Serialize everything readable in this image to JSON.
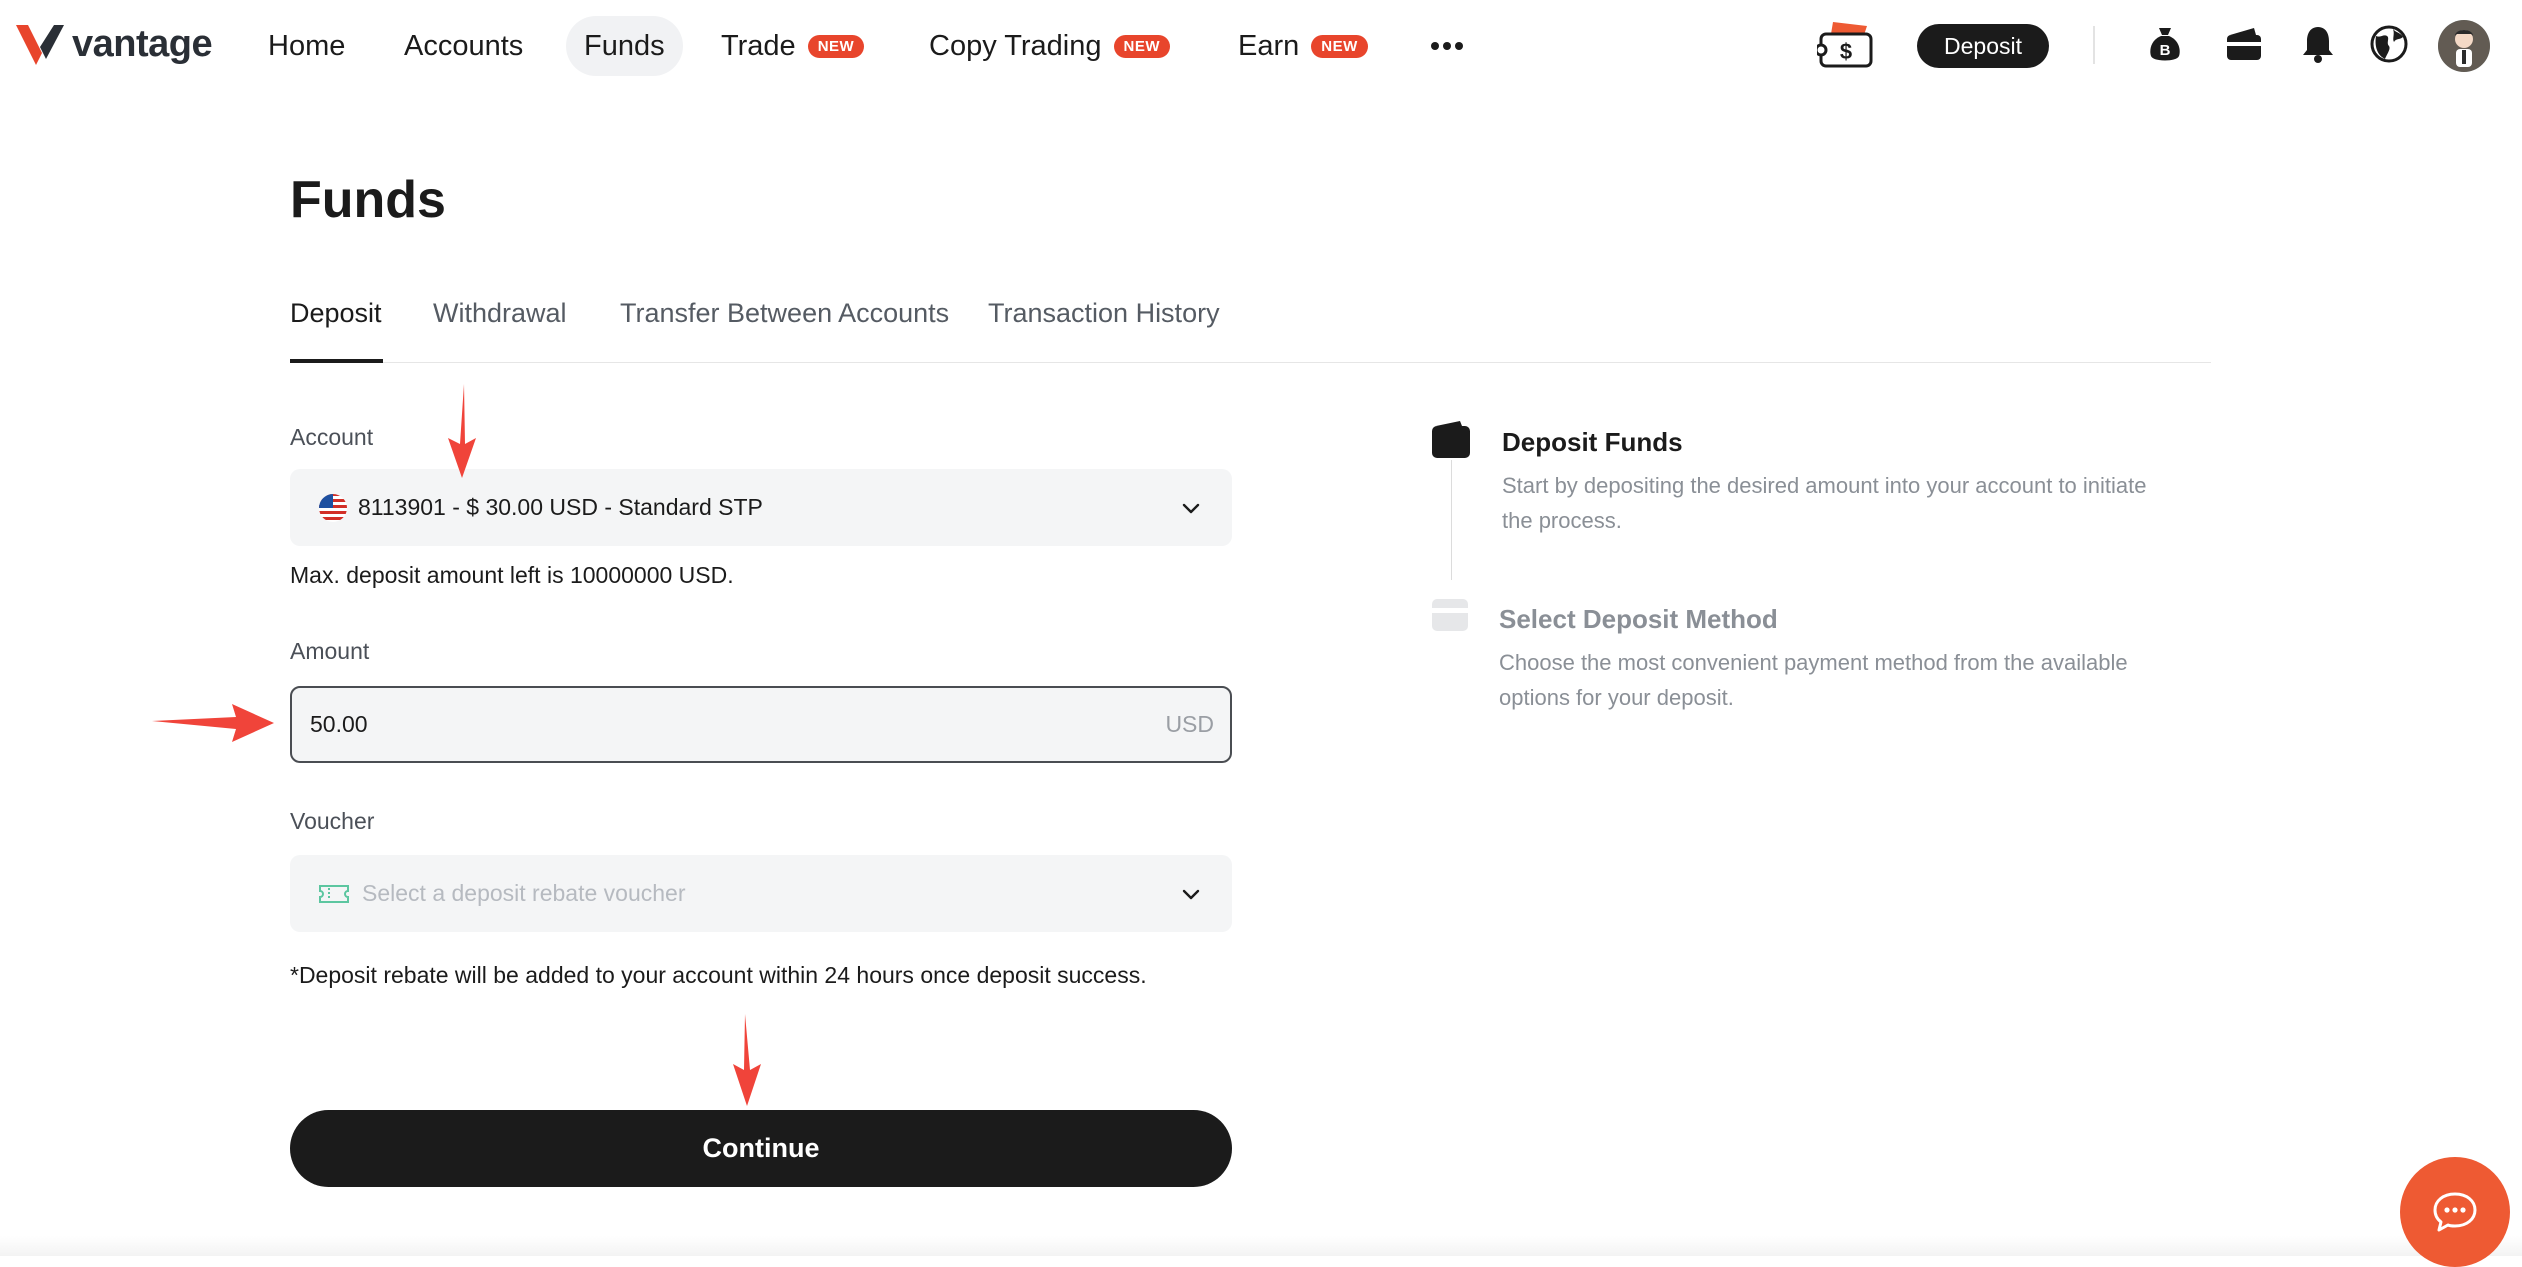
{
  "brand": {
    "name": "vantage",
    "accent": "#e8452c"
  },
  "nav": {
    "items": [
      {
        "label": "Home"
      },
      {
        "label": "Accounts"
      },
      {
        "label": "Funds"
      },
      {
        "label": "Trade",
        "badge": "NEW"
      },
      {
        "label": "Copy Trading",
        "badge": "NEW"
      },
      {
        "label": "Earn",
        "badge": "NEW"
      }
    ],
    "more_icon": "more-horizontal-icon",
    "deposit_label": "Deposit",
    "icons": [
      "cashback-icon",
      "bitcoin-bag-icon",
      "wallet-icon",
      "bell-icon",
      "globe-icon",
      "user-avatar"
    ]
  },
  "page": {
    "title": "Funds",
    "tabs": [
      {
        "label": "Deposit",
        "active": true
      },
      {
        "label": "Withdrawal"
      },
      {
        "label": "Transfer Between Accounts"
      },
      {
        "label": "Transaction History"
      }
    ]
  },
  "form": {
    "account_label": "Account",
    "account_value": "8113901 - $ 30.00 USD - Standard STP",
    "max_note": "Max. deposit amount left is 10000000 USD.",
    "amount_label": "Amount",
    "amount_value": "50.00",
    "amount_currency": "USD",
    "voucher_label": "Voucher",
    "voucher_placeholder": "Select a deposit rebate voucher",
    "rebate_note": "*Deposit rebate will be added to your account within 24 hours once deposit success.",
    "continue_label": "Continue"
  },
  "steps": [
    {
      "title": "Deposit Funds",
      "desc": "Start by depositing the desired amount into your account to initiate the process.",
      "active": true
    },
    {
      "title": "Select Deposit Method",
      "desc": "Choose the most convenient payment method from the available options for your deposit.",
      "active": false
    }
  ],
  "annotation_color": "#f0443a"
}
